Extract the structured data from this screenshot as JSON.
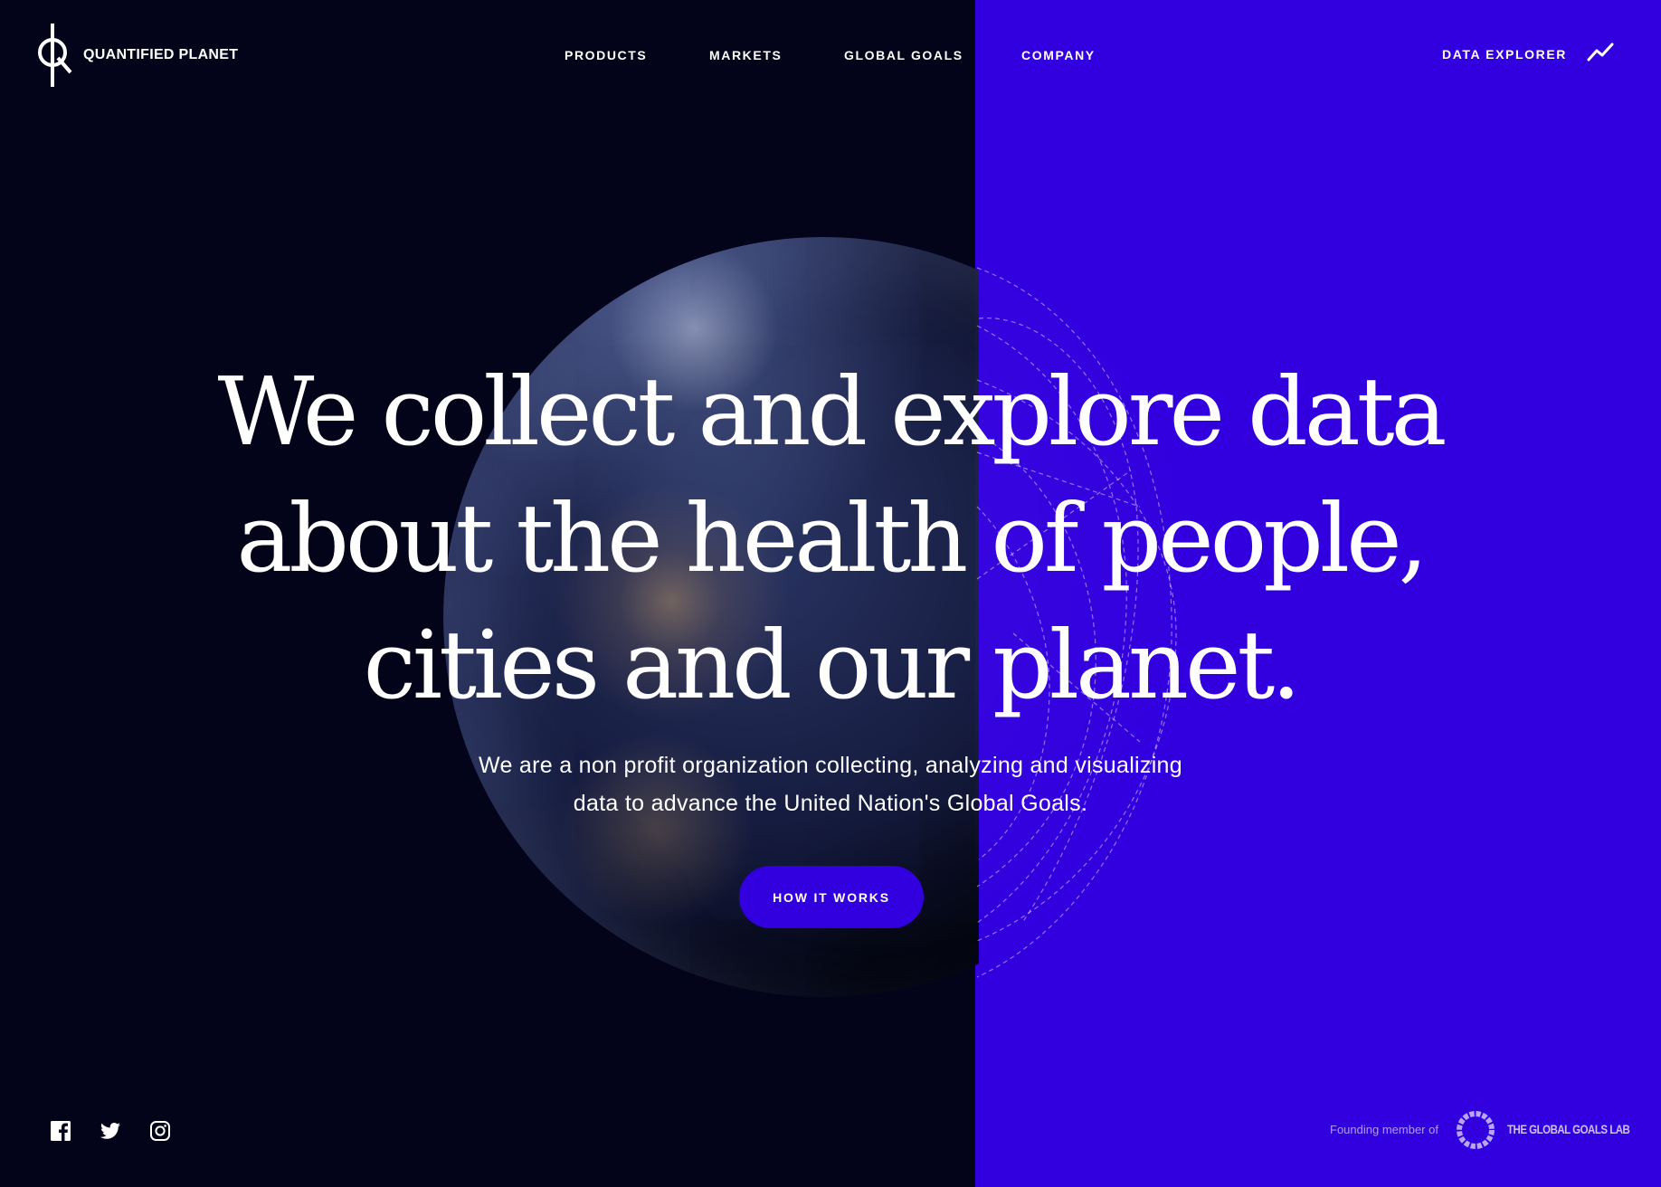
{
  "brand": {
    "name": "QUANTIFIED PLANET"
  },
  "nav": {
    "items": [
      {
        "label": "PRODUCTS"
      },
      {
        "label": "MARKETS"
      },
      {
        "label": "GLOBAL GOALS"
      },
      {
        "label": "COMPANY"
      }
    ],
    "data_explorer_label": "DATA EXPLORER",
    "data_explorer_icon": "trend-line-icon"
  },
  "hero": {
    "headline_lines": [
      "We collect and explore data",
      "about the health of people,",
      "cities and our planet."
    ],
    "subtext_lines": [
      "We are a non profit organization collecting, analyzing and visualizing",
      "data to advance the United Nation's Global Goals."
    ],
    "cta_label": "HOW IT WORKS"
  },
  "footer": {
    "social_icons": [
      "facebook-icon",
      "twitter-icon",
      "instagram-icon"
    ],
    "founding_label": "Founding member of",
    "partner_name": "THE GLOBAL GOALS LAB"
  },
  "colors": {
    "dark_background": "#03031a",
    "accent_blue": "#3200de",
    "text": "#ffffff"
  }
}
